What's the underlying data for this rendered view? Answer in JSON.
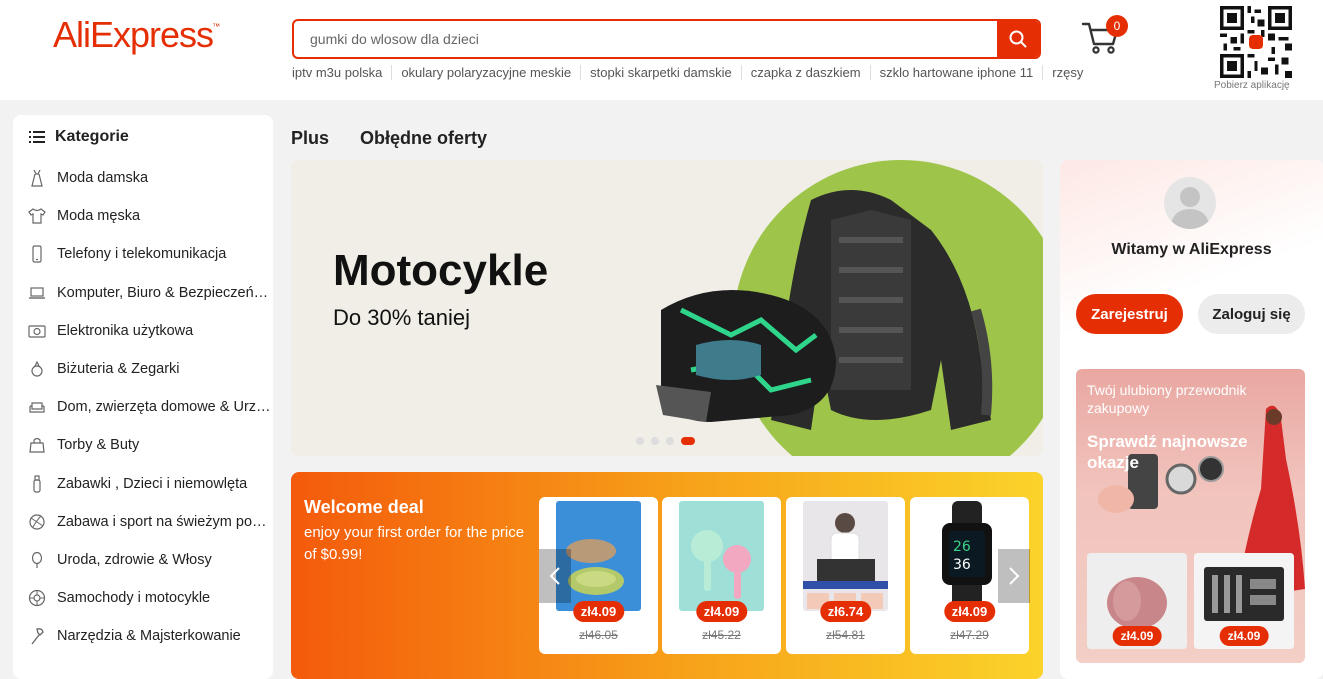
{
  "header": {
    "logo": "AliExpress",
    "logo_tm": "™",
    "search_value": "gumki do wlosow dla dzieci",
    "hot_keywords": [
      "iptv m3u polska",
      "okulary polaryzacyjne meskie",
      "stopki skarpetki damskie",
      "czapka z daszkiem",
      "szklo hartowane iphone 11",
      "rzęsy"
    ],
    "cart_count": "0",
    "qr_label": "Pobierz aplikację",
    "accent": "#e62e04"
  },
  "categories": {
    "title": "Kategorie",
    "items": [
      {
        "label": "Moda damska",
        "icon": "dress-icon"
      },
      {
        "label": "Moda męska",
        "icon": "shirt-icon"
      },
      {
        "label": "Telefony i telekomunikacja",
        "icon": "phone-icon"
      },
      {
        "label": "Komputer, Biuro & Bezpieczeństwo",
        "icon": "laptop-icon"
      },
      {
        "label": "Elektronika użytkowa",
        "icon": "camera-icon"
      },
      {
        "label": "Biżuteria & Zegarki",
        "icon": "ring-icon"
      },
      {
        "label": "Dom, zwierzęta domowe & Urządzenia",
        "icon": "sofa-icon"
      },
      {
        "label": "Torby & Buty",
        "icon": "bag-icon"
      },
      {
        "label": "Zabawki , Dzieci i niemowlęta",
        "icon": "bottle-icon"
      },
      {
        "label": "Zabawa i sport na świeżym powietrzu",
        "icon": "ball-icon"
      },
      {
        "label": "Uroda, zdrowie & Włosy",
        "icon": "mirror-icon"
      },
      {
        "label": "Samochody i motocykle",
        "icon": "wheel-icon"
      },
      {
        "label": "Narzędzia & Majsterkowanie",
        "icon": "tool-icon"
      }
    ]
  },
  "tabs": [
    "Plus",
    "Obłędne oferty"
  ],
  "banner": {
    "title": "Motocykle",
    "subtitle": "Do 30% taniej",
    "slides": 4,
    "active_slide": 4
  },
  "welcome_deal": {
    "title": "Welcome deal",
    "description": "enjoy your first order for the price of $0.99!",
    "products": [
      {
        "price": "zł4.09",
        "old_price": "zł46.05"
      },
      {
        "price": "zł4.09",
        "old_price": "zł45.22"
      },
      {
        "price": "zł6.74",
        "old_price": "zł54.81"
      },
      {
        "price": "zł4.09",
        "old_price": "zł47.29"
      }
    ]
  },
  "account": {
    "welcome": "Witamy w AliExpress",
    "register": "Zarejestruj",
    "login": "Zaloguj się"
  },
  "guide": {
    "line1": "Twój ulubiony przewodnik zakupowy",
    "line2": "Sprawdź najnowsze okazje",
    "cards": [
      {
        "price": "zł4.09"
      },
      {
        "price": "zł4.09"
      }
    ]
  }
}
